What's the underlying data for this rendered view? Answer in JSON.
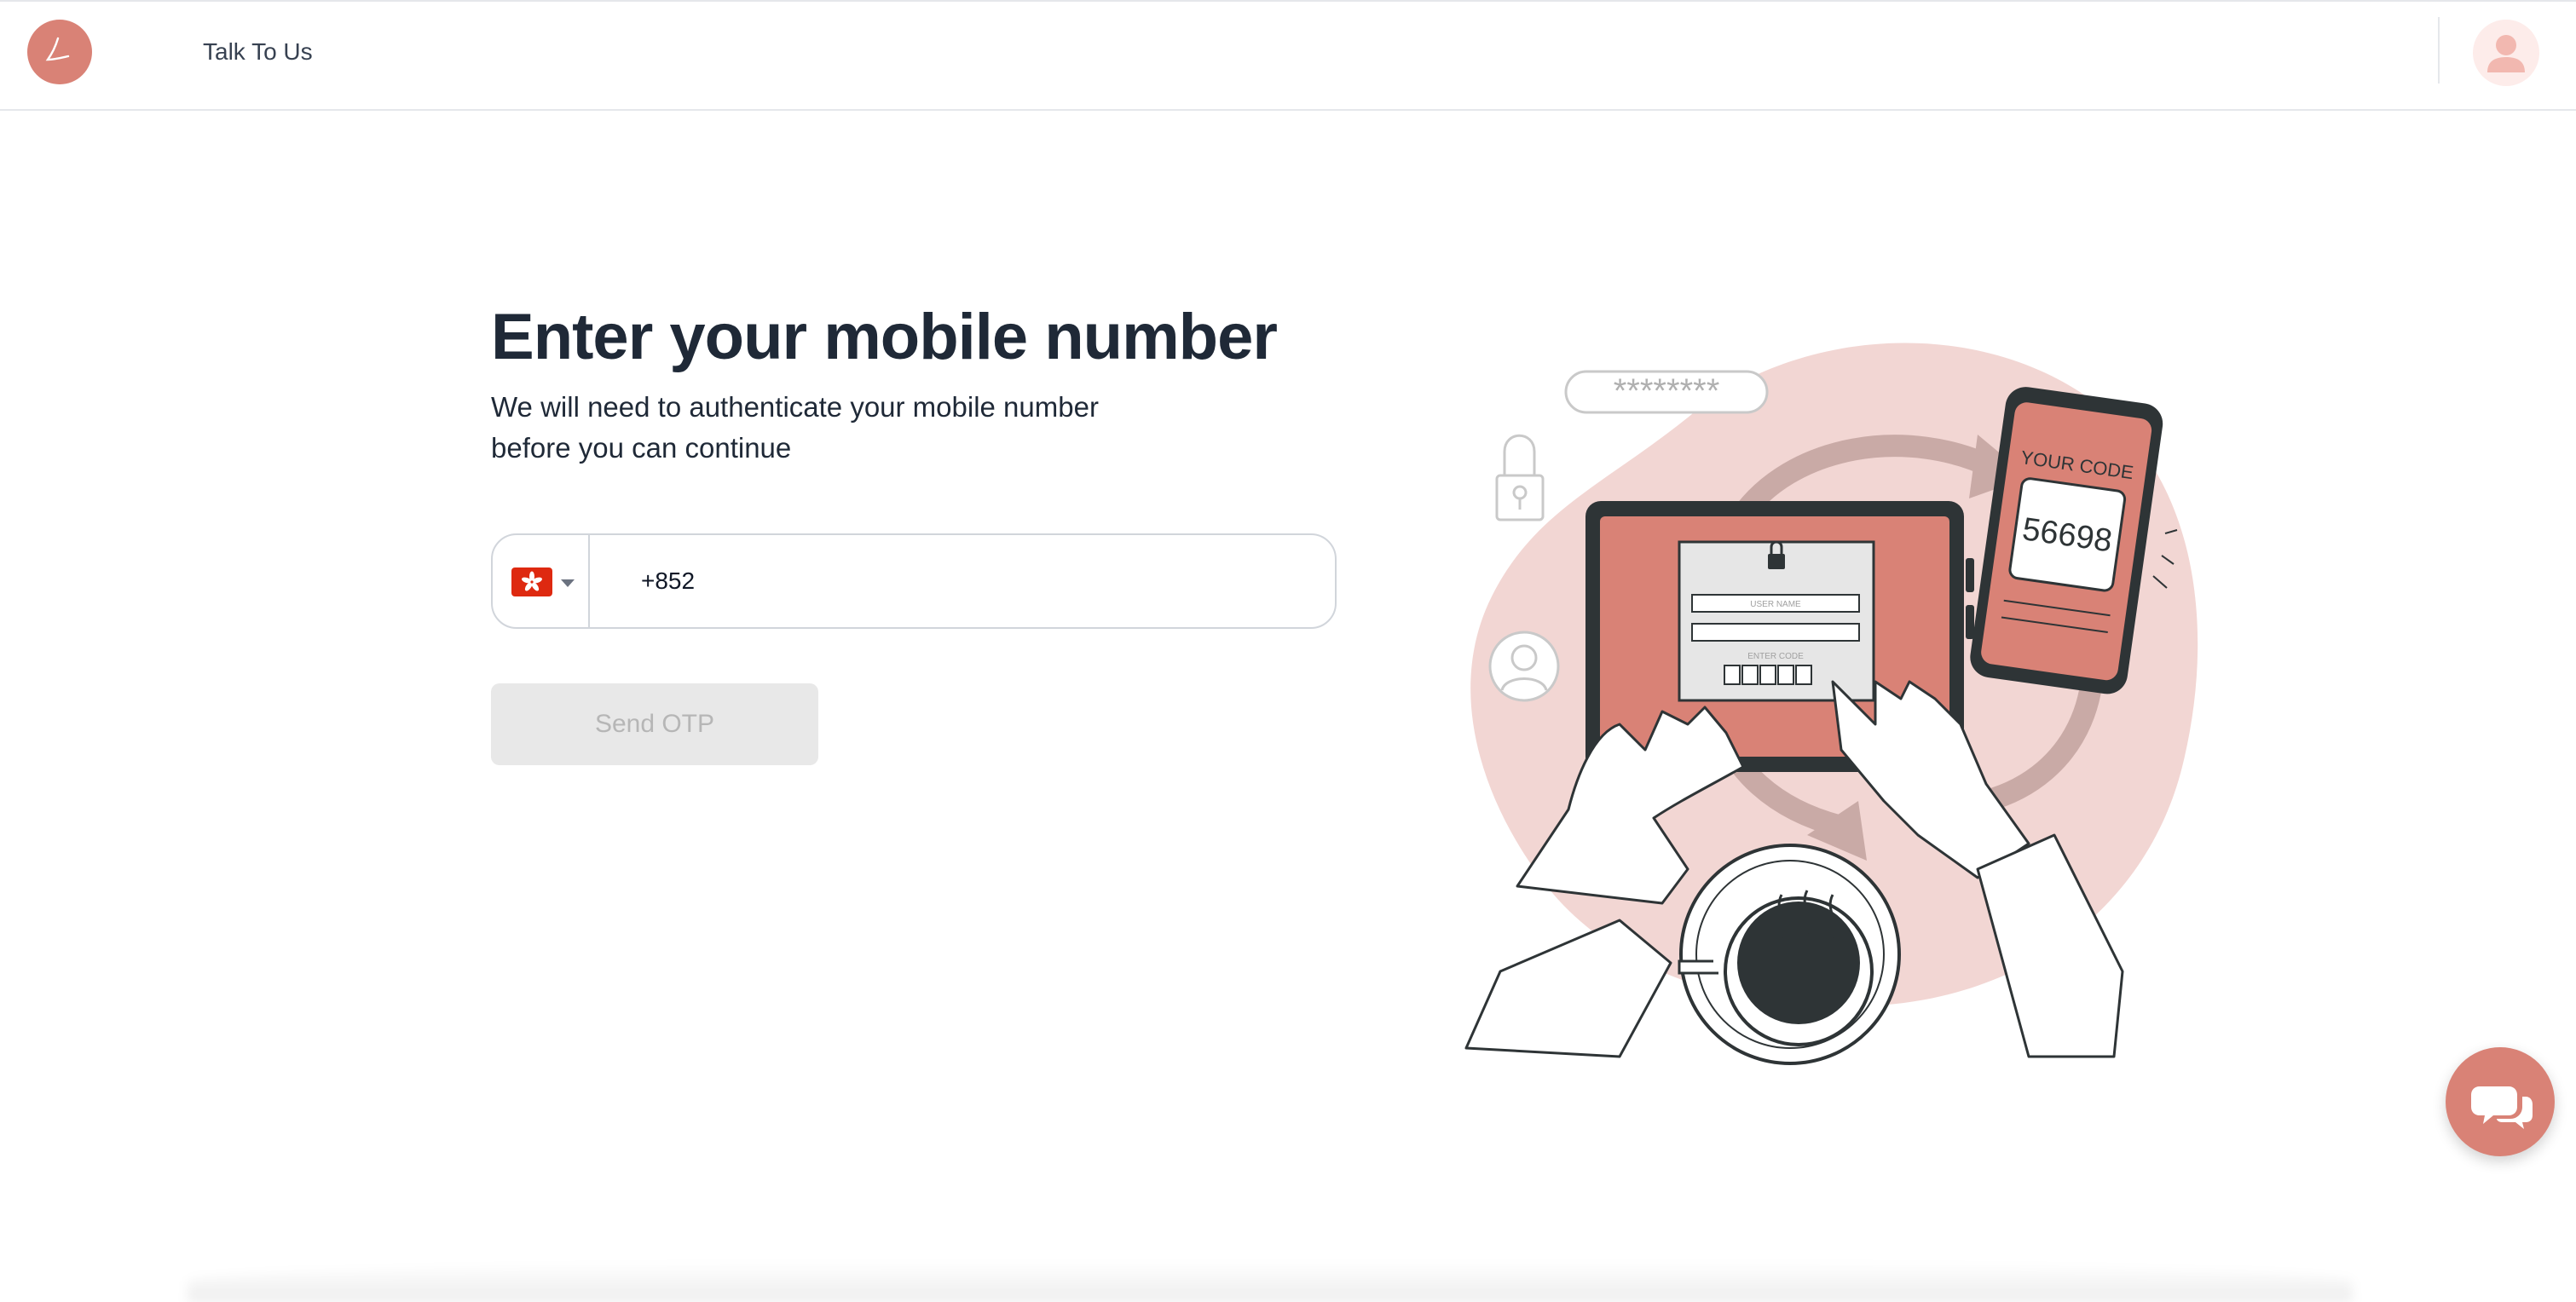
{
  "header": {
    "nav_link": "Talk To Us"
  },
  "main": {
    "title": "Enter your mobile number",
    "subtitle_line1": "We will need to authenticate your mobile number",
    "subtitle_line2": "before you can continue",
    "phone": {
      "country_flag": "hong-kong-flag",
      "dial_code_value": "+852"
    },
    "send_button_label": "Send OTP",
    "send_button_enabled": false
  },
  "illustration": {
    "password_mask": "********",
    "tablet_username_label": "USER NAME",
    "tablet_enter_code_label": "ENTER CODE",
    "phone_screen_heading": "YOUR CODE",
    "phone_screen_code": "56698"
  },
  "icons": {
    "logo": "brand-logo",
    "avatar": "user-avatar-icon",
    "chat": "chat-bubbles-icon"
  },
  "colors": {
    "brand": "#d98276",
    "brand_light": "#f2d6d3",
    "disabled_bg": "#e8e8e8",
    "disabled_text": "#b6b6b6",
    "heading": "#1f2937"
  }
}
